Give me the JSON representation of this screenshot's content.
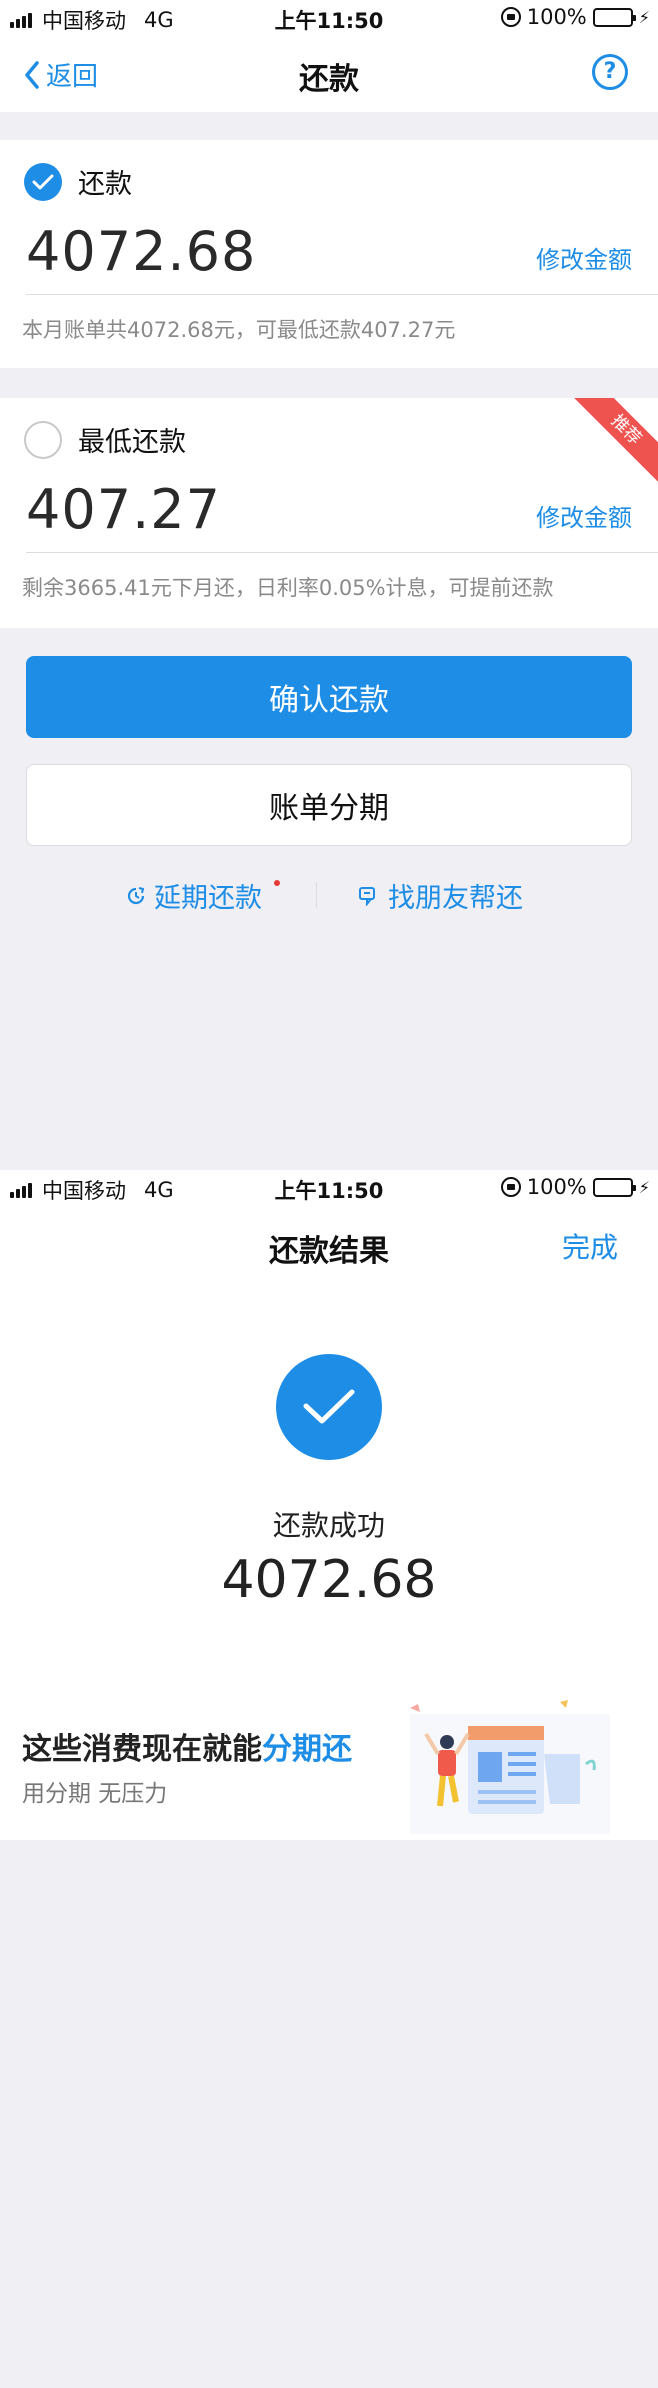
{
  "status": {
    "carrier": "中国移动",
    "network": "4G",
    "time": "上午11:50",
    "battery": "100%"
  },
  "pay": {
    "nav": {
      "back_label": "返回",
      "title": "还款",
      "help_icon": "?"
    },
    "full": {
      "label": "还款",
      "amount": "4072.68",
      "modify_label": "修改金额",
      "note": "本月账单共4072.68元，可最低还款407.27元",
      "selected": true
    },
    "minimum": {
      "label": "最低还款",
      "amount": "407.27",
      "modify_label": "修改金额",
      "note": "剩余3665.41元下月还，日利率0.05%计息，可提前还款",
      "ribbon": "推荐",
      "selected": false
    },
    "confirm_label": "确认还款",
    "installment_label": "账单分期",
    "defer_label": "延期还款",
    "friend_label": "找朋友帮还"
  },
  "result": {
    "title": "还款结果",
    "done_label": "完成",
    "success_label": "还款成功",
    "amount": "4072.68",
    "banner": {
      "headline_prefix": "这些消费现在就能",
      "headline_highlight": "分期还",
      "sub": "用分期 无压力"
    }
  },
  "colors": {
    "accent": "#1e8de6",
    "ribbon": "#ef5350",
    "battery": "#4cd964"
  }
}
